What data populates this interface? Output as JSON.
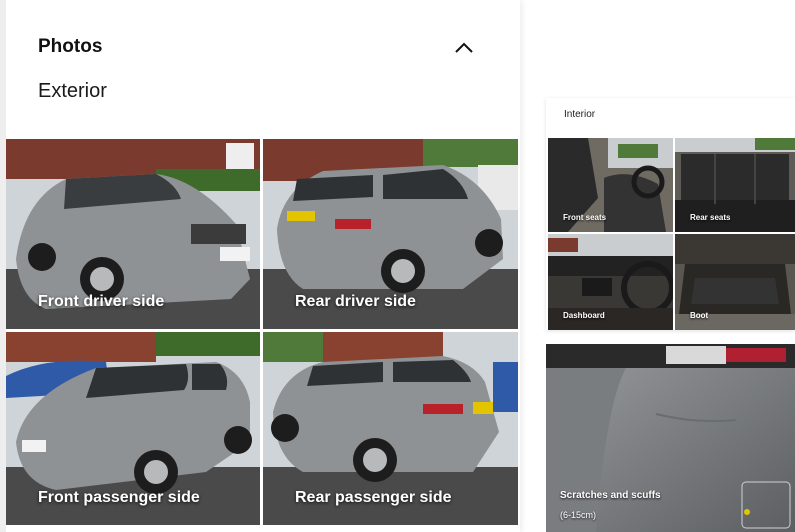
{
  "photos": {
    "title": "Photos",
    "toggle_icon": "chevron-up-icon",
    "exterior": {
      "label": "Exterior",
      "tiles": [
        {
          "label": "Front driver side"
        },
        {
          "label": "Rear driver side"
        },
        {
          "label": "Front passenger side"
        },
        {
          "label": "Rear passenger side"
        }
      ]
    }
  },
  "interior": {
    "label": "Interior",
    "tiles": [
      {
        "label": "Front seats"
      },
      {
        "label": "Rear seats"
      },
      {
        "label": "Dashboard"
      },
      {
        "label": "Boot"
      }
    ]
  },
  "damage": {
    "label": "Scratches and scuffs",
    "size": "(6-15cm)"
  },
  "colors": {
    "car_body": "#8f9294",
    "brick": "#7a3b2e",
    "sky": "#d9dde2",
    "tarmac": "#4a4a4a",
    "interior_leather": "#2a2a2a"
  }
}
